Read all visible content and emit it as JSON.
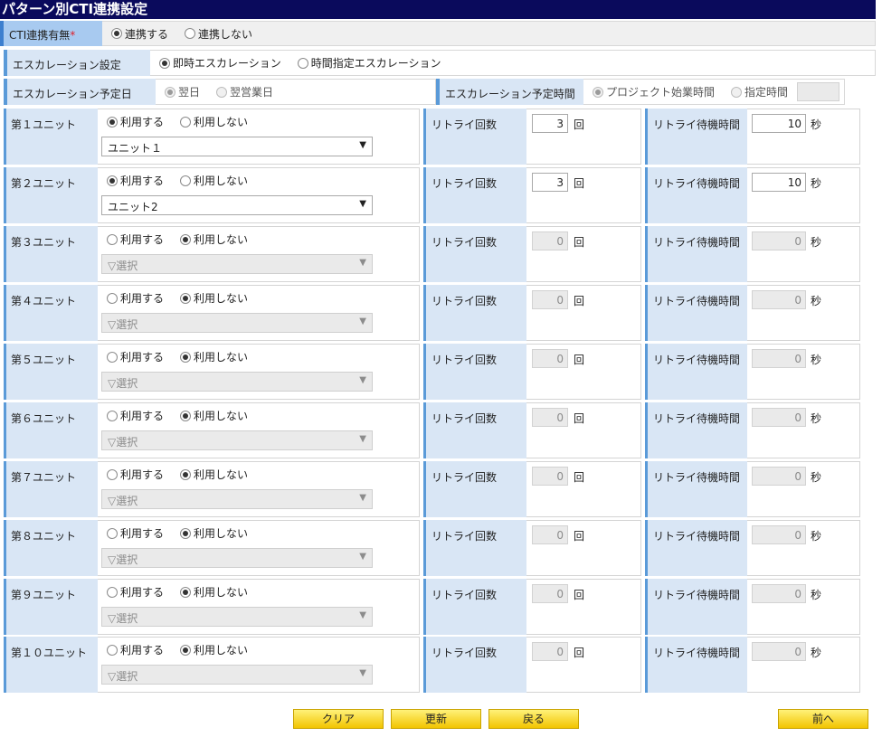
{
  "title": "パターン別CTI連携設定",
  "cti": {
    "label": "CTI連携有無",
    "required_mark": "*",
    "options": [
      "連携する",
      "連携しない"
    ],
    "selected": 0
  },
  "escalation": {
    "label": "エスカレーション設定",
    "options": [
      "即時エスカレーション",
      "時間指定エスカレーション"
    ],
    "selected": 0
  },
  "escalation_day": {
    "label": "エスカレーション予定日",
    "options": [
      "翌日",
      "翌営業日"
    ],
    "selected": 0
  },
  "escalation_time": {
    "label": "エスカレーション予定時間",
    "options": [
      "プロジェクト始業時間",
      "指定時間"
    ],
    "selected": 0,
    "time_value": ""
  },
  "unit_use_options": [
    "利用する",
    "利用しない"
  ],
  "retry_label": "リトライ回数",
  "retry_suffix": "回",
  "wait_label": "リトライ待機時間",
  "wait_suffix": "秒",
  "units": [
    {
      "label": "第１ユニット",
      "use": 0,
      "select": "ユニット１",
      "retry": "3",
      "wait": "10"
    },
    {
      "label": "第２ユニット",
      "use": 0,
      "select": "ユニット2",
      "retry": "3",
      "wait": "10"
    },
    {
      "label": "第３ユニット",
      "use": 1,
      "select": "▽選択",
      "retry": "0",
      "wait": "0"
    },
    {
      "label": "第４ユニット",
      "use": 1,
      "select": "▽選択",
      "retry": "0",
      "wait": "0"
    },
    {
      "label": "第５ユニット",
      "use": 1,
      "select": "▽選択",
      "retry": "0",
      "wait": "0"
    },
    {
      "label": "第６ユニット",
      "use": 1,
      "select": "▽選択",
      "retry": "0",
      "wait": "0"
    },
    {
      "label": "第７ユニット",
      "use": 1,
      "select": "▽選択",
      "retry": "0",
      "wait": "0"
    },
    {
      "label": "第８ユニット",
      "use": 1,
      "select": "▽選択",
      "retry": "0",
      "wait": "0"
    },
    {
      "label": "第９ユニット",
      "use": 1,
      "select": "▽選択",
      "retry": "0",
      "wait": "0"
    },
    {
      "label": "第１０ユニット",
      "use": 1,
      "select": "▽選択",
      "retry": "0",
      "wait": "0"
    }
  ],
  "buttons": {
    "clear": "クリア",
    "update": "更新",
    "back": "戻る",
    "prev": "前へ"
  }
}
